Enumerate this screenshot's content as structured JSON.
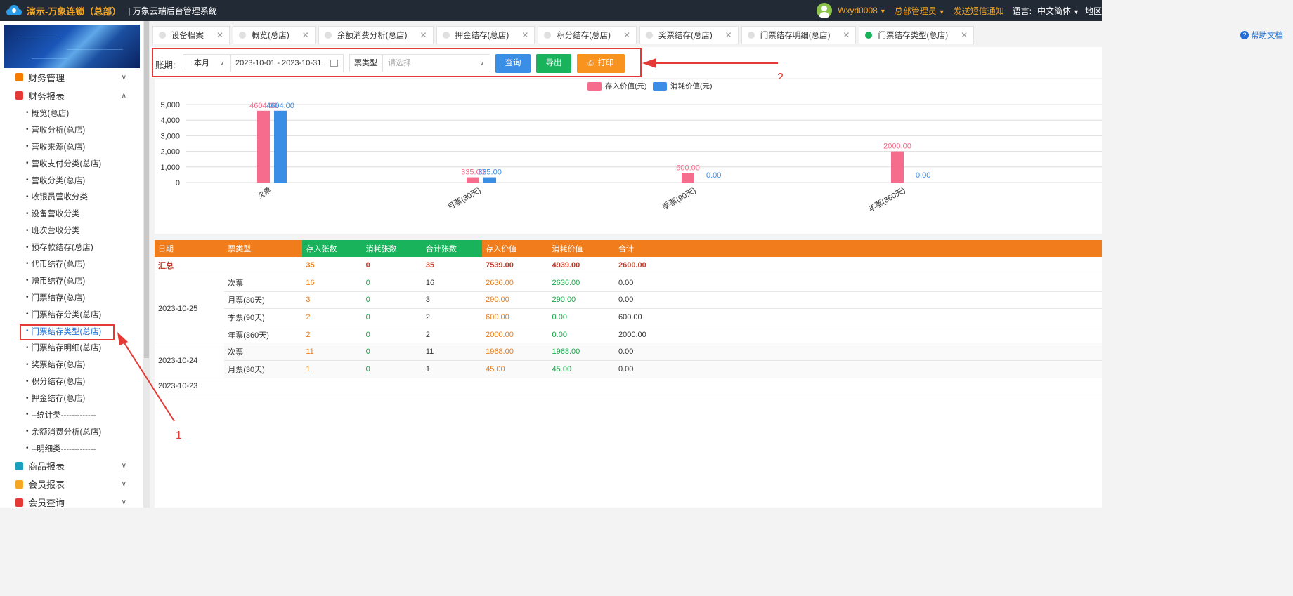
{
  "header": {
    "brand": "演示-万象连锁（总部）",
    "system_name": "| 万象云端后台管理系统",
    "username": "Wxyd0008",
    "role": "总部管理员",
    "sms": "发送短信通知",
    "lang_label": "语言:",
    "lang_value": "中文简体",
    "region": "地区"
  },
  "sidebar": {
    "groups_top": [
      {
        "label": "财务管理",
        "color": "#f57c00"
      },
      {
        "label": "财务报表",
        "color": "#e53935"
      }
    ],
    "items": [
      "概览(总店)",
      "营收分析(总店)",
      "营收来源(总店)",
      "营收支付分类(总店)",
      "营收分类(总店)",
      "收银员营收分类",
      "设备营收分类",
      "班次营收分类",
      "预存款结存(总店)",
      "代币结存(总店)",
      "赠币结存(总店)",
      "门票结存(总店)",
      "门票结存分类(总店)",
      "门票结存类型(总店)",
      "门票结存明细(总店)",
      "奖票结存(总店)",
      "积分结存(总店)",
      "押金结存(总店)",
      "--统计类-------------",
      "余额消费分析(总店)",
      "--明细类-------------"
    ],
    "active_index": 13,
    "groups_bottom": [
      {
        "label": "商品报表",
        "color": "#1a9fbf"
      },
      {
        "label": "会员报表",
        "color": "#f5a623"
      },
      {
        "label": "会员查询",
        "color": "#e53935"
      }
    ]
  },
  "tabs": [
    {
      "label": "设备档案",
      "active": false
    },
    {
      "label": "概览(总店)",
      "active": false
    },
    {
      "label": "余额消费分析(总店)",
      "active": false
    },
    {
      "label": "押金结存(总店)",
      "active": false
    },
    {
      "label": "积分结存(总店)",
      "active": false
    },
    {
      "label": "奖票结存(总店)",
      "active": false
    },
    {
      "label": "门票结存明细(总店)",
      "active": false
    },
    {
      "label": "门票结存类型(总店)",
      "active": true
    }
  ],
  "help_doc": "帮助文档",
  "filter": {
    "period_label": "账期:",
    "period_value": "本月",
    "date_range": "2023-10-01 - 2023-10-31",
    "type_label": "票类型",
    "type_placeholder": "请选择",
    "query": "查询",
    "export": "导出",
    "print": "打印"
  },
  "annotations": {
    "arrow1_label": "1",
    "arrow2_label": "2"
  },
  "chart_data": {
    "type": "bar",
    "categories": [
      "次票",
      "月票(30天)",
      "季票(90天)",
      "年票(360天)"
    ],
    "series": [
      {
        "name": "存入价值(元)",
        "color": "#f56c8c",
        "values": [
          4604.0,
          335.0,
          600.0,
          2000.0
        ]
      },
      {
        "name": "消耗价值(元)",
        "color": "#3a8ee6",
        "values": [
          4604.0,
          335.0,
          0.0,
          0.0
        ]
      }
    ],
    "yticks": [
      0,
      1000,
      2000,
      3000,
      4000,
      5000
    ],
    "ylim": [
      0,
      5000
    ],
    "legend_position": "top-center",
    "grid": true
  },
  "table": {
    "headers": [
      "日期",
      "票类型",
      "存入张数",
      "消耗张数",
      "合计张数",
      "存入价值",
      "消耗价值",
      "合计"
    ],
    "summary": {
      "label": "汇总",
      "values": [
        "35",
        "0",
        "35",
        "7539.00",
        "4939.00",
        "2600.00"
      ]
    },
    "groups": [
      {
        "date": "2023-10-25",
        "rows": [
          {
            "type": "次票",
            "in": "16",
            "out": "0",
            "total": "16",
            "in_val": "2636.00",
            "out_val": "2636.00",
            "sum": "0.00"
          },
          {
            "type": "月票(30天)",
            "in": "3",
            "out": "0",
            "total": "3",
            "in_val": "290.00",
            "out_val": "290.00",
            "sum": "0.00"
          },
          {
            "type": "季票(90天)",
            "in": "2",
            "out": "0",
            "total": "2",
            "in_val": "600.00",
            "out_val": "0.00",
            "sum": "600.00"
          },
          {
            "type": "年票(360天)",
            "in": "2",
            "out": "0",
            "total": "2",
            "in_val": "2000.00",
            "out_val": "0.00",
            "sum": "2000.00"
          }
        ]
      },
      {
        "date": "2023-10-24",
        "rows": [
          {
            "type": "次票",
            "in": "11",
            "out": "0",
            "total": "11",
            "in_val": "1968.00",
            "out_val": "1968.00",
            "sum": "0.00"
          },
          {
            "type": "月票(30天)",
            "in": "1",
            "out": "0",
            "total": "1",
            "in_val": "45.00",
            "out_val": "45.00",
            "sum": "0.00"
          }
        ]
      },
      {
        "date": "2023-10-23",
        "rows": []
      }
    ]
  }
}
